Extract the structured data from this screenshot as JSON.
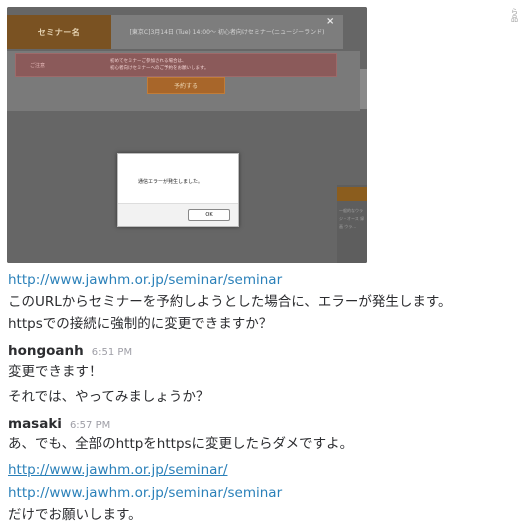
{
  "embedded_screenshot": {
    "seminar_label": "セミナー名",
    "seminar_value": "[東京C]3月14日 (Tue) 14:00～ 初心者向けセミナー(ニュージーランド)",
    "close_glyph": "×",
    "alert_label": "ご注意",
    "alert_line1": "初めてセミナーご参加される場合は、",
    "alert_line2": "初心者向けセミナーへのご予約をお願いします。",
    "alert_link": "初心者向けセミナー",
    "reserve_button": "予約する",
    "dialog_message": "通信エラーが発生しました。",
    "dialog_ok": "OK",
    "right_side_text": "一般的なウラ ジ・オース 録画 ウラ…",
    "right_side_icon": "ま"
  },
  "edge_fragments": {
    "top": "ら",
    "second": "品"
  },
  "messages": [
    {
      "id": "m1",
      "link": "http://www.jawhm.or.jp/seminar/seminar",
      "text1": "このURLからセミナーを予約しようとした場合に、エラーが発生します。",
      "text2": "httpsでの接続に強制的に変更できますか？"
    },
    {
      "id": "m2",
      "sender": "hongoanh",
      "time": "6:51 PM",
      "text1": "変更できます！",
      "text2": "それでは、やってみましょうか？"
    },
    {
      "id": "m3",
      "sender": "masaki",
      "time": "6:57 PM",
      "text1": "あ、でも、全部のhttpをhttpsに変更したらダメですよ。",
      "link1": "http://www.jawhm.or.jp/seminar/",
      "link2": "http://www.jawhm.or.jp/seminar/seminar",
      "text2": "だけでお願いします。"
    }
  ],
  "colors": {
    "link": "#2a80b9",
    "text": "#2c2d30",
    "timestamp": "#9e9ea6"
  }
}
